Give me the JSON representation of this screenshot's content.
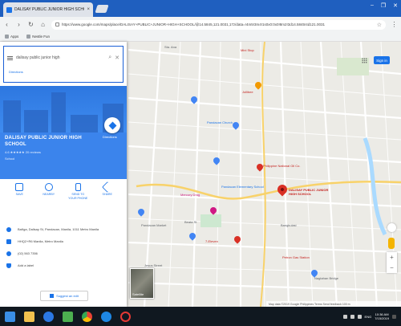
{
  "browser": {
    "tab_title": "DALISAY PUBLIC JUNIOR HIGH SCHOOL - Google Maps",
    "tab_close": "×",
    "window_controls": [
      "–",
      "❐",
      "✕"
    ],
    "back": "‹",
    "forward": "›",
    "reload": "↻",
    "home": "⌂",
    "url": "https://www.google.com/maps/place/DALISAY+PUBLIC+JUNIOR+HIGH+SCHOOL/@14.5845,121.0031,17z/data=!4m5!3m4!1s0x0:0x0!8m2!3d14.5845!4d121.0031",
    "star": "☆",
    "menu_dots": "⋮",
    "bookmarks": [
      {
        "label": "Apps"
      },
      {
        "label": "Nestle Fun"
      }
    ]
  },
  "panel": {
    "search_value": "dalisay public junior high",
    "search_icon": "⌕",
    "close_icon": "✕",
    "directions_link": "Directions",
    "place_name": "DALISAY PUBLIC JUNIOR HIGH SCHOOL",
    "rating": "4.6 ★★★★★ 20 reviews",
    "place_type": "School",
    "directions_label": "Directions",
    "actions": [
      {
        "label": "SAVE",
        "icon": "bookmark-icon"
      },
      {
        "label": "NEARBY",
        "icon": "nearby-icon"
      },
      {
        "label": "SEND TO YOUR PHONE",
        "icon": "phone-icon"
      },
      {
        "label": "SHARE",
        "icon": "share-icon"
      }
    ],
    "details": [
      {
        "icon": "location-pin-icon",
        "text": "Bañga, Dalisay St, Pandacan, Manila, 1011 Metro Manila"
      },
      {
        "icon": "plus-code-icon",
        "text": "HHQ2+R6 Manila, Metro Manila"
      },
      {
        "icon": "phone-icon",
        "text": "(02) 563 7356"
      },
      {
        "icon": "label-icon",
        "text": "Add a label"
      }
    ],
    "suggest_edit": "Suggest an edit"
  },
  "map": {
    "sign_in": "Sign in",
    "zoom_in": "+",
    "zoom_out": "−",
    "satellite_label": "Satellite",
    "selected_place_label": "DALISAY PUBLIC JUNIOR HIGH SCHOOL",
    "status_text": "Map data ©2019 Google  Philippines  Terms  Send feedback  100 m",
    "labels": [
      {
        "text": "Sta. Ana",
        "kind": "plain"
      },
      {
        "text": "Mini Stop",
        "kind": "red"
      },
      {
        "text": "Jollibee",
        "kind": "red"
      },
      {
        "text": "Pandacan Church",
        "kind": "blue"
      },
      {
        "text": "Pandacan Elementary School",
        "kind": "blue"
      },
      {
        "text": "Philippine National Oil Co.",
        "kind": "red"
      },
      {
        "text": "Mercury Drug",
        "kind": "pink"
      },
      {
        "text": "Pandacan Market",
        "kind": "plain"
      },
      {
        "text": "Beata St",
        "kind": "plain"
      },
      {
        "text": "Bangkulasi",
        "kind": "plain"
      },
      {
        "text": "7-Eleven",
        "kind": "red"
      },
      {
        "text": "Petron Gas Station",
        "kind": "red"
      },
      {
        "text": "Jesus Street",
        "kind": "plain"
      },
      {
        "text": "Nagtahan Bridge",
        "kind": "plain"
      }
    ]
  },
  "taskbar": {
    "apps": [
      {
        "name": "windows-start-icon",
        "color": "#3a8ee6"
      },
      {
        "name": "file-explorer-icon",
        "color": "#f2c14e"
      },
      {
        "name": "edge-browser-icon",
        "color": "#2b78e4"
      },
      {
        "name": "photos-icon",
        "color": "#4caf50"
      },
      {
        "name": "chrome-icon",
        "color": "#e94235"
      },
      {
        "name": "media-player-icon",
        "color": "#1e88e5"
      },
      {
        "name": "opera-icon",
        "color": "#e53935"
      }
    ],
    "tray_text": "ENG",
    "time": "10:36 AM",
    "date": "7/15/2019"
  },
  "colors": {
    "accent": "#1a73e8",
    "panel_blue": "#3b84ec",
    "map_bg": "#ecebe6"
  }
}
